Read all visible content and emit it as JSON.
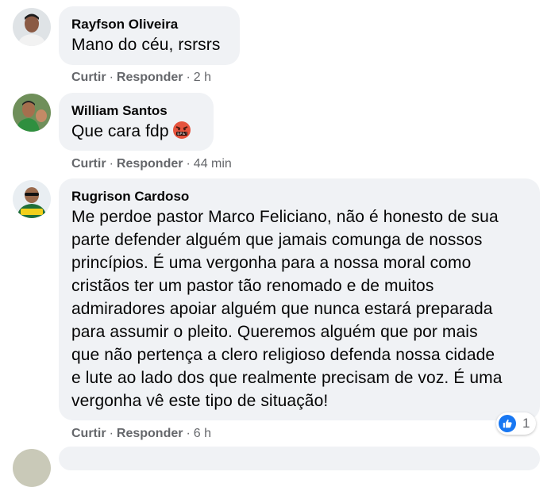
{
  "comments": [
    {
      "author": "Rayfson Oliveira",
      "text": "Mano do céu, rsrsrs",
      "like_label": "Curtir",
      "reply_label": "Responder",
      "time": "2 h",
      "avatar": "avatar-photo"
    },
    {
      "author": "William Santos",
      "text": "Que cara fdp",
      "emoji": "angry-cursing-face-emoji",
      "like_label": "Curtir",
      "reply_label": "Responder",
      "time": "44 min",
      "avatar": "avatar-photo"
    },
    {
      "author": "Rugrison Cardoso",
      "text_lines": [
        "Me perdoe pastor Marco Feliciano, não é honesto de sua",
        "parte defender alguém que jamais comunga de nossos",
        "princípios. É uma vergonha para a nossa moral como",
        "cristãos ter um pastor tão renomado e de muitos",
        "admiradores apoiar alguém que nunca estará preparada",
        "para assumir o pleito. Queremos alguém que por mais",
        "que não pertença a clero religioso defenda nossa cidade",
        "e lute ao lado dos que realmente precisam de voz. É uma",
        "vergonha vê este tipo de situação!"
      ],
      "like_label": "Curtir",
      "reply_label": "Responder",
      "time": "6 h",
      "reaction": {
        "icon": "thumbs-up-icon",
        "count": "1",
        "color": "#1877f2"
      },
      "avatar": "avatar-photo"
    }
  ],
  "colors": {
    "bubble": "#f0f2f5",
    "meta_text": "#65676b",
    "like_blue": "#1877f2"
  },
  "separator": "·"
}
